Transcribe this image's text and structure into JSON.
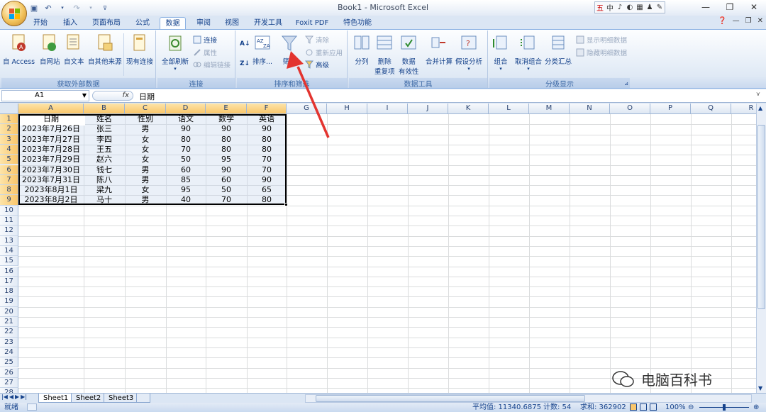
{
  "window": {
    "title": "Book1 - Microsoft Excel"
  },
  "ime": [
    "五",
    "中",
    "♪",
    "◐",
    "▦",
    "♟",
    "✎"
  ],
  "tabs": [
    "开始",
    "插入",
    "页面布局",
    "公式",
    "数据",
    "审阅",
    "视图",
    "开发工具",
    "Foxit PDF",
    "特色功能"
  ],
  "active_tab": "数据",
  "ribbon": {
    "groups": {
      "external": "获取外部数据",
      "connections": "连接",
      "sort_filter": "排序和筛选",
      "data_tools": "数据工具",
      "outline": "分级显示"
    },
    "buttons": {
      "from_access": "自 Access",
      "from_web": "自网站",
      "from_text": "自文本",
      "from_other": "自其他来源",
      "existing_conn": "现有连接",
      "refresh_all": "全部刷新",
      "connections": "连接",
      "properties": "属性",
      "edit_links": "编辑链接",
      "sort": "排序...",
      "filter": "筛选",
      "clear": "清除",
      "reapply": "重新应用",
      "advanced": "高级",
      "text_to_columns": "分列",
      "remove_dup_1": "删除",
      "remove_dup_2": "重复项",
      "validation_1": "数据",
      "validation_2": "有效性",
      "consolidate": "合并计算",
      "whatif": "假设分析",
      "group": "组合",
      "ungroup": "取消组合",
      "subtotal": "分类汇总",
      "show_detail": "显示明细数据",
      "hide_detail": "隐藏明细数据"
    }
  },
  "formula_bar": {
    "name_box": "A1",
    "fx": "fx",
    "content": "日期"
  },
  "columns": [
    "A",
    "B",
    "C",
    "D",
    "E",
    "F",
    "G",
    "H",
    "I",
    "J",
    "K",
    "L",
    "M",
    "N",
    "O",
    "P",
    "Q",
    "R"
  ],
  "rows": [
    "1",
    "2",
    "3",
    "4",
    "5",
    "6",
    "7",
    "8",
    "9",
    "10",
    "11",
    "12",
    "13",
    "14",
    "15",
    "16",
    "17",
    "18",
    "19",
    "20",
    "21",
    "22",
    "23",
    "24",
    "25",
    "26",
    "27",
    "28"
  ],
  "table": {
    "headers": [
      "日期",
      "姓名",
      "性别",
      "语文",
      "数学",
      "英语"
    ],
    "rows": [
      [
        "2023年7月26日",
        "张三",
        "男",
        "90",
        "90",
        "90"
      ],
      [
        "2023年7月27日",
        "李四",
        "女",
        "80",
        "80",
        "80"
      ],
      [
        "2023年7月28日",
        "王五",
        "女",
        "70",
        "80",
        "80"
      ],
      [
        "2023年7月29日",
        "赵六",
        "女",
        "50",
        "95",
        "70"
      ],
      [
        "2023年7月30日",
        "钱七",
        "男",
        "60",
        "90",
        "70"
      ],
      [
        "2023年7月31日",
        "陈八",
        "男",
        "85",
        "60",
        "90"
      ],
      [
        "2023年8月1日",
        "梁九",
        "女",
        "95",
        "50",
        "65"
      ],
      [
        "2023年8月2日",
        "马十",
        "男",
        "40",
        "70",
        "80"
      ]
    ]
  },
  "sheets": [
    "Sheet1",
    "Sheet2",
    "Sheet3"
  ],
  "status": {
    "ready": "就绪",
    "average": "平均值: 11340.6875",
    "count": "计数: 54",
    "sum": "求和: 362902",
    "zoom": "100%"
  },
  "watermark": "电脑百科书",
  "colors": {
    "accent": "#15428b",
    "arrow": "#e3342f"
  }
}
